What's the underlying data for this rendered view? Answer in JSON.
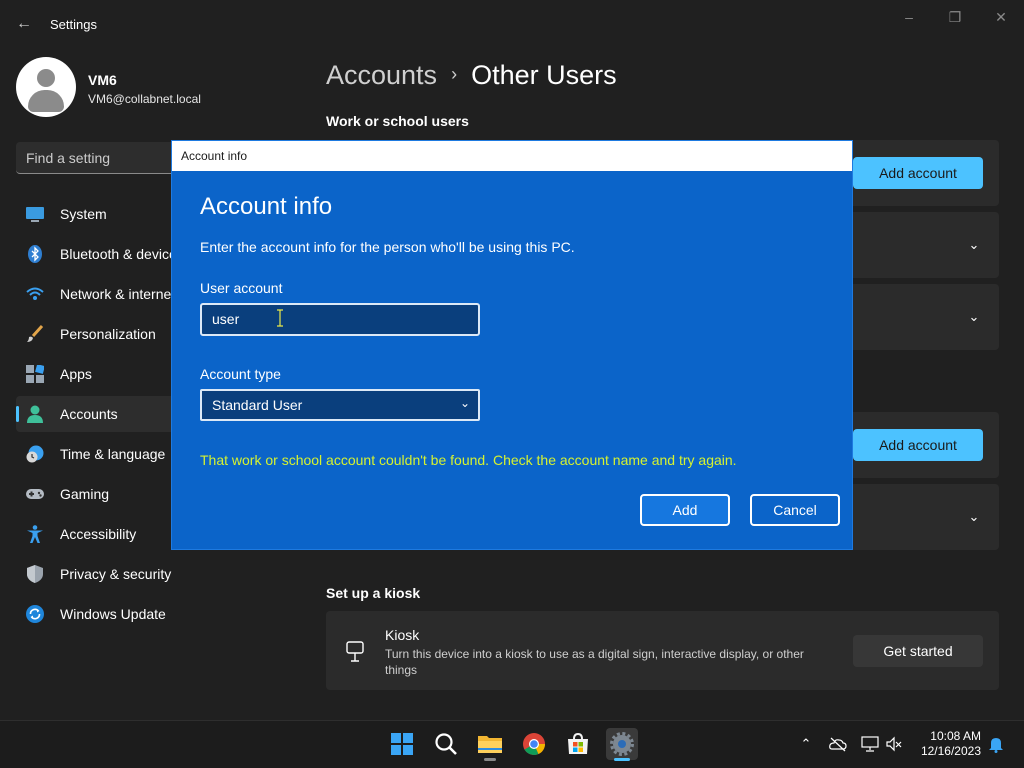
{
  "window": {
    "title": "Settings",
    "back_icon": "back-arrow-icon",
    "controls": [
      "minimize-icon",
      "restore-icon",
      "close-icon"
    ]
  },
  "profile": {
    "name": "VM6",
    "email": "VM6@collabnet.local"
  },
  "search": {
    "placeholder": "Find a setting"
  },
  "sidebar": {
    "items": [
      {
        "label": "System",
        "icon": "system-icon",
        "active": false
      },
      {
        "label": "Bluetooth & devices",
        "icon": "bluetooth-icon",
        "active": false
      },
      {
        "label": "Network & internet",
        "icon": "wifi-icon",
        "active": false
      },
      {
        "label": "Personalization",
        "icon": "brush-icon",
        "active": false
      },
      {
        "label": "Apps",
        "icon": "apps-icon",
        "active": false
      },
      {
        "label": "Accounts",
        "icon": "accounts-icon",
        "active": true
      },
      {
        "label": "Time & language",
        "icon": "time-language-icon",
        "active": false
      },
      {
        "label": "Gaming",
        "icon": "gamepad-icon",
        "active": false
      },
      {
        "label": "Accessibility",
        "icon": "accessibility-icon",
        "active": false
      },
      {
        "label": "Privacy & security",
        "icon": "shield-icon",
        "active": false
      },
      {
        "label": "Windows Update",
        "icon": "update-icon",
        "active": false
      }
    ]
  },
  "main": {
    "breadcrumb_parent": "Accounts",
    "breadcrumb_separator": "›",
    "breadcrumb_current": "Other Users",
    "work_section_title": "Work or school users",
    "add_account_label": "Add account",
    "add_account_label_2": "Add account",
    "kiosk_section_title": "Set up a kiosk",
    "kiosk_title": "Kiosk",
    "kiosk_description": "Turn this device into a kiosk to use as a digital sign, interactive display, or other things",
    "kiosk_button": "Get started"
  },
  "dialog": {
    "window_title": "Account info",
    "heading": "Account info",
    "description": "Enter the account info for the person who'll be using this PC.",
    "user_account_label": "User account",
    "user_account_value": "user",
    "account_type_label": "Account type",
    "account_type_value": "Standard User",
    "error_message": "That work or school account couldn't be found. Check the account name and try again.",
    "add_button": "Add",
    "cancel_button": "Cancel"
  },
  "taskbar": {
    "apps": [
      "start-icon",
      "search-icon",
      "file-explorer-icon",
      "chrome-icon",
      "store-icon",
      "settings-icon"
    ],
    "clock_time": "10:08 AM",
    "clock_date": "12/16/2023"
  },
  "colors": {
    "accent": "#4cc2ff",
    "dialog_bg": "#0b64c9",
    "error_text": "#d6f230",
    "background": "#202020"
  }
}
